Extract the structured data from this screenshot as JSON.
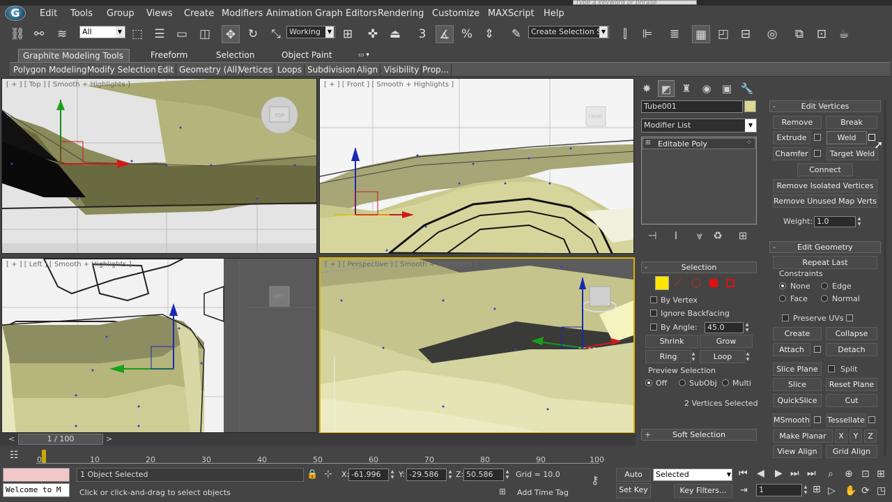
{
  "app": {
    "logo_letter": "G",
    "search_placeholder": "Type a keyword or phrase"
  },
  "menu": [
    "Edit",
    "Tools",
    "Group",
    "Views",
    "Create",
    "Modifiers",
    "Animation",
    "Graph Editors",
    "Rendering",
    "Customize",
    "MAXScript",
    "Help"
  ],
  "toolbar": {
    "selection_filter": "All",
    "ref_coord": "Working",
    "named_selection": "Create Selection Se",
    "snap_label": "3"
  },
  "ribbon": {
    "tabs": [
      "Graphite Modeling Tools",
      "Freeform",
      "Selection",
      "Object Paint"
    ],
    "panels": [
      "Polygon Modeling",
      "Modify Selection",
      "Edit",
      "Geometry (All)",
      "Vertices",
      "Loops",
      "Subdivision",
      "Align",
      "Visibility",
      "Prop..."
    ]
  },
  "viewports": {
    "top": "[ + ] [ Top ] [ Smooth + Highlights ]",
    "front": "[ + ] [ Front ] [ Smooth + Highlights ]",
    "left": "[ + ] [ Left ] [ Smooth + Highlights ]",
    "persp": "[ + ] [ Perspective ] [ Smooth + Highlights ]",
    "cube_top": "TOP",
    "cube_front": "FRONT",
    "cube_left": "LEFT"
  },
  "command_panel": {
    "object_name": "Tube001",
    "object_color": "#d8d890",
    "modifier_list": "Modifier List",
    "stack_item": "Editable Poly",
    "selection": {
      "title": "Selection",
      "by_vertex": "By Vertex",
      "ignore_backfacing": "Ignore Backfacing",
      "by_angle": "By Angle:",
      "angle_value": "45.0",
      "shrink": "Shrink",
      "grow": "Grow",
      "ring": "Ring",
      "loop": "Loop",
      "preview_title": "Preview Selection",
      "off": "Off",
      "subobj": "SubObj",
      "multi": "Multi",
      "status": "2 Vertices Selected"
    },
    "soft_selection": "Soft Selection",
    "edit_vertices": {
      "title": "Edit Vertices",
      "remove": "Remove",
      "break": "Break",
      "extrude": "Extrude",
      "weld": "Weld",
      "chamfer": "Chamfer",
      "target_weld": "Target Weld",
      "connect": "Connect",
      "remove_isolated": "Remove Isolated Vertices",
      "remove_unused": "Remove Unused Map Verts",
      "weight_label": "Weight:",
      "weight_value": "1.0"
    },
    "edit_geometry": {
      "title": "Edit Geometry",
      "repeat_last": "Repeat Last",
      "constraints": "Constraints",
      "none": "None",
      "edge": "Edge",
      "face": "Face",
      "normal": "Normal",
      "preserve_uvs": "Preserve UVs",
      "create": "Create",
      "collapse": "Collapse",
      "attach": "Attach",
      "detach": "Detach",
      "slice_plane": "Slice Plane",
      "split": "Split",
      "slice": "Slice",
      "reset_plane": "Reset Plane",
      "quickslice": "QuickSlice",
      "cut": "Cut",
      "msmooth": "MSmooth",
      "tessellate": "Tessellate",
      "make_planar": "Make Planar",
      "x": "X",
      "y": "Y",
      "z": "Z",
      "view_align": "View Align",
      "grid_align": "Grid Align"
    }
  },
  "timeline": {
    "frame": "1 / 100",
    "ticks": [
      "0",
      "10",
      "20",
      "30",
      "40",
      "50",
      "60",
      "70",
      "80",
      "90",
      "100"
    ]
  },
  "status": {
    "maxscript": "Welcome to M",
    "selected": "1 Object Selected",
    "prompt": "Click or click-and-drag to select objects",
    "x_label": "X:",
    "x": "-61.996",
    "y_label": "Y:",
    "y": "-29.586",
    "z_label": "Z:",
    "z": "50.586",
    "grid": "Grid = 10.0",
    "add_time_tag": "Add Time Tag",
    "auto_key": "Auto Key",
    "key_mode": "Selected",
    "set_key": "Set Key",
    "key_filters": "Key Filters...",
    "current_frame": "1"
  }
}
